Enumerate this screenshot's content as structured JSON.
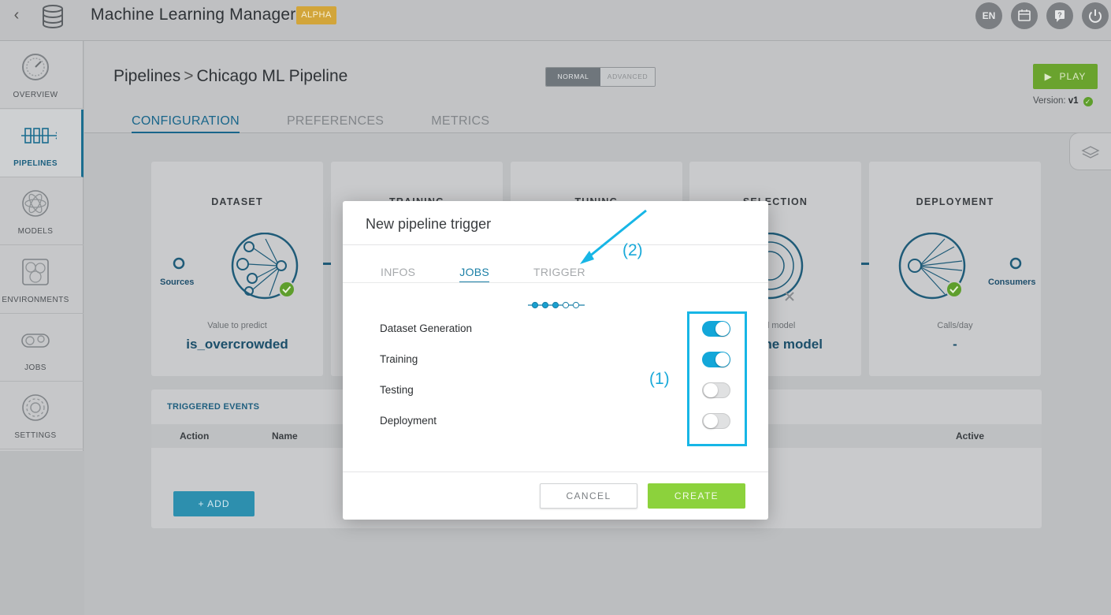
{
  "app": {
    "title": "Machine Learning Manager",
    "badge": "ALPHA",
    "top_icons": [
      {
        "name": "language",
        "label": "EN"
      },
      {
        "name": "calendar-icon",
        "label": ""
      },
      {
        "name": "help-icon",
        "label": ""
      },
      {
        "name": "power-icon",
        "label": ""
      }
    ]
  },
  "sidebar": {
    "items": [
      {
        "label": "OVERVIEW",
        "icon": "gauge-icon"
      },
      {
        "label": "PIPELINES",
        "icon": "pipeline-icon",
        "active": true
      },
      {
        "label": "MODELS",
        "icon": "atom-icon"
      },
      {
        "label": "ENVIRONMENTS",
        "icon": "cube-icon"
      },
      {
        "label": "JOBS",
        "icon": "gears-icon"
      },
      {
        "label": "SETTINGS",
        "icon": "gear-icon"
      }
    ]
  },
  "header": {
    "breadcrumb": {
      "root": "Pipelines",
      "separator": ">",
      "current": "Chicago ML Pipeline"
    },
    "mode": {
      "normal": "NORMAL",
      "advanced": "ADVANCED"
    },
    "play": "PLAY",
    "version_label": "Version:",
    "version_value": "v1",
    "tabs": [
      "CONFIGURATION",
      "PREFERENCES",
      "METRICS"
    ]
  },
  "pipeline": {
    "sources_label": "Sources",
    "consumers_label": "Consumers",
    "steps": [
      {
        "title": "DATASET",
        "sub": "Value to predict",
        "value": "is_overcrowded"
      },
      {
        "title": "TRAINING",
        "sub": "",
        "value": ""
      },
      {
        "title": "TUNING",
        "sub": "",
        "value": ""
      },
      {
        "title": "SELECTION",
        "sub": "yed model",
        "value": "Pipeline model"
      },
      {
        "title": "DEPLOYMENT",
        "sub": "Calls/day",
        "value": "-"
      }
    ]
  },
  "events": {
    "title": "TRIGGERED EVENTS",
    "columns": {
      "action": "Action",
      "name": "Name",
      "active": "Active"
    },
    "add_label": "+ ADD"
  },
  "modal": {
    "title": "New pipeline trigger",
    "tabs": [
      "INFOS",
      "JOBS",
      "TRIGGER"
    ],
    "active_tab": "JOBS",
    "jobs": [
      {
        "label": "Dataset Generation",
        "enabled": true
      },
      {
        "label": "Training",
        "enabled": true
      },
      {
        "label": "Testing",
        "enabled": false
      },
      {
        "label": "Deployment",
        "enabled": false
      }
    ],
    "cancel": "CANCEL",
    "create": "CREATE"
  },
  "annotations": {
    "one": "(1)",
    "two": "(2)"
  },
  "colors": {
    "accent": "#1a7fa6",
    "toggle_on": "#13a7d9",
    "create": "#8cd23c",
    "highlight": "#17b6e6",
    "play": "#6aa32e"
  }
}
